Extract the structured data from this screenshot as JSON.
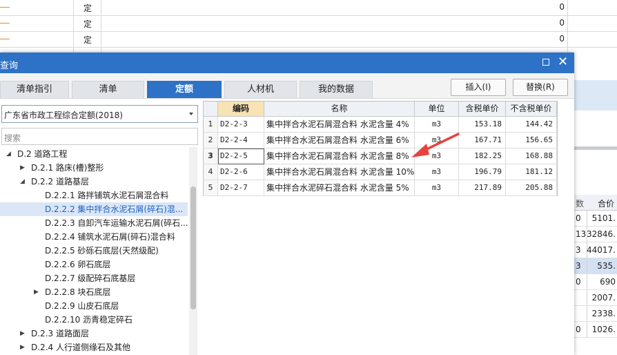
{
  "background": {
    "rows": [
      {
        "unit": "定",
        "qty": "0"
      },
      {
        "unit": "定",
        "qty": "0"
      },
      {
        "unit": "定",
        "qty": "0"
      }
    ],
    "right_table": {
      "header": "合价",
      "header_partial": "数",
      "rows": [
        {
          "qty": "0",
          "price": "5101."
        },
        {
          "qty": "13",
          "price": "32846."
        },
        {
          "qty": "3",
          "price": "44017."
        },
        {
          "qty": "3",
          "price": "535."
        },
        {
          "qty": "0",
          "price": "690"
        },
        {
          "qty": "",
          "price": "2007."
        },
        {
          "qty": "",
          "price": "2338."
        },
        {
          "qty": "0",
          "price": "1026."
        }
      ]
    }
  },
  "dialog": {
    "title": "查询",
    "tabs": [
      "清单指引",
      "清单",
      "定额",
      "人材机",
      "我的数据"
    ],
    "active_tab": "定额",
    "buttons": {
      "insert": "插入(I)",
      "replace": "替换(R)"
    },
    "combo": {
      "value": "广东省市政工程综合定额(2018)"
    },
    "search": {
      "placeholder": "搜索"
    },
    "tree": [
      {
        "label": "D.2 道路工程",
        "expander": "◢"
      },
      {
        "label": "D.2.1 路床(槽)整形",
        "expander": "▶"
      },
      {
        "label": "D.2.2 道路基层",
        "expander": "◢"
      },
      {
        "label": "D.2.2.1 路拌铺筑水泥石屑混合料",
        "expander": ""
      },
      {
        "label": "D.2.2.2 集中拌合水泥石屑(碎石)混...",
        "expander": "",
        "selected": true
      },
      {
        "label": "D.2.2.3 自卸汽车运输水泥石屑(碎石...",
        "expander": ""
      },
      {
        "label": "D.2.2.4 铺筑水泥石屑(碎石)混合料",
        "expander": ""
      },
      {
        "label": "D.2.2.5 砂砾石底层(天然级配)",
        "expander": ""
      },
      {
        "label": "D.2.2.6 卵石底层",
        "expander": ""
      },
      {
        "label": "D.2.2.7 级配碎石底基层",
        "expander": ""
      },
      {
        "label": "D.2.2.8 块石底层",
        "expander": "▶"
      },
      {
        "label": "D.2.2.9 山皮石底层",
        "expander": ""
      },
      {
        "label": "D.2.2.10 沥青稳定碎石",
        "expander": ""
      },
      {
        "label": "D.2.3 道路面层",
        "expander": "▶"
      },
      {
        "label": "D.2.4 人行道侧缘石及其他",
        "expander": "▶"
      }
    ],
    "grid": {
      "columns": [
        "编码",
        "名称",
        "单位",
        "含税单价",
        "不含税单价"
      ],
      "rows": [
        {
          "no": "1",
          "code": "D2-2-3",
          "name": "集中拌合水泥石屑混合料 水泥含量 4%",
          "unit": "m3",
          "tax_price": "153.18",
          "notax_price": "144.42"
        },
        {
          "no": "2",
          "code": "D2-2-4",
          "name": "集中拌合水泥石屑混合料 水泥含量 6%",
          "unit": "m3",
          "tax_price": "167.71",
          "notax_price": "156.65"
        },
        {
          "no": "3",
          "code": "D2-2-5",
          "name": "集中拌合水泥石屑混合料 水泥含量 8%",
          "unit": "m3",
          "tax_price": "182.25",
          "notax_price": "168.88"
        },
        {
          "no": "4",
          "code": "D2-2-6",
          "name": "集中拌合水泥石屑混合料 水泥含量 10%",
          "unit": "m3",
          "tax_price": "196.79",
          "notax_price": "181.12"
        },
        {
          "no": "5",
          "code": "D2-2-7",
          "name": "集中拌合水泥碎石混合料 水泥含量 5%",
          "unit": "m3",
          "tax_price": "217.89",
          "notax_price": "205.88"
        }
      ],
      "focused_row": 3
    }
  },
  "colors": {
    "accent": "#2d72c6",
    "arrow": "#e8423f",
    "header_active": "#f8e3b4"
  }
}
